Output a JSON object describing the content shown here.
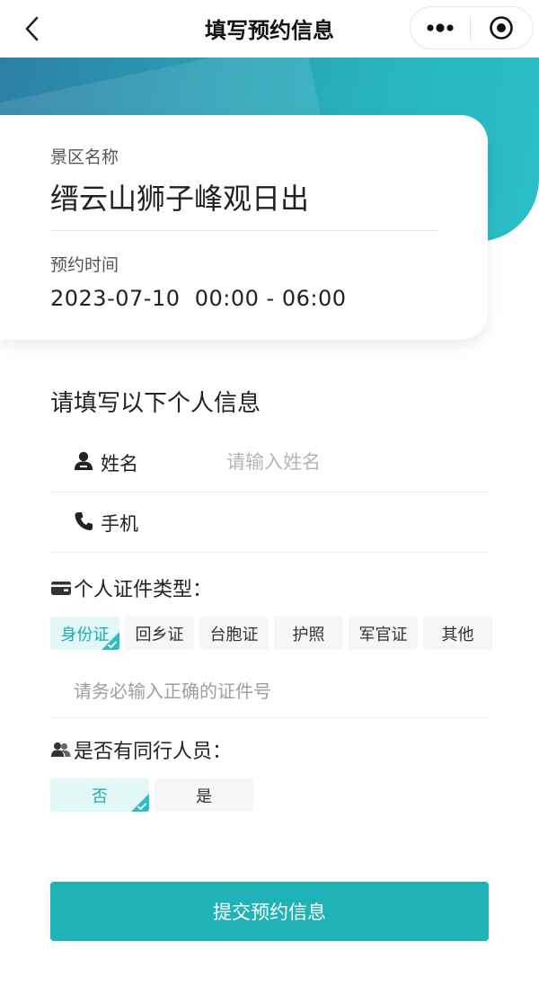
{
  "nav": {
    "title": "填写预约信息",
    "back_icon": "chevron-left-icon",
    "more_icon": "more-dots-icon",
    "close_icon": "target-circle-icon"
  },
  "card": {
    "scenic_label": "景区名称",
    "scenic_name": "缙云山狮子峰观日出",
    "time_label": "预约时间",
    "time_value": "2023-07-10  00:00 - 06:00"
  },
  "form": {
    "section_title": "请填写以下个人信息",
    "name": {
      "label": "姓名",
      "icon": "user-icon",
      "value": "",
      "placeholder": "请输入姓名"
    },
    "phone": {
      "label": "手机",
      "icon": "phone-icon",
      "value": "",
      "placeholder": ""
    },
    "id_type": {
      "title": "个人证件类型：",
      "icon": "card-icon",
      "options": [
        "身份证",
        "回乡证",
        "台胞证",
        "护照",
        "军官证",
        "其他"
      ],
      "selected": "身份证"
    },
    "id_number": {
      "value": "",
      "placeholder": "请务必输入正确的证件号"
    },
    "companions": {
      "title": "是否有同行人员：",
      "icon": "group-icon",
      "options": [
        "否",
        "是"
      ],
      "selected": "否"
    },
    "submit_label": "提交预约信息"
  },
  "colors": {
    "accent": "#1fb2b7",
    "selected_bg": "#e3f7f7",
    "banner": "#27b7c2"
  }
}
